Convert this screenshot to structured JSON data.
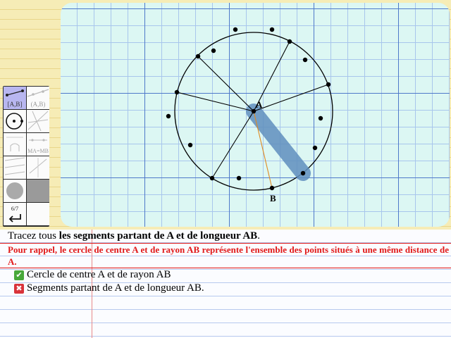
{
  "canvas": {
    "point_a_label": "A",
    "point_b_label": "B"
  },
  "toolbar": {
    "segment_tool_label": "[A,B]",
    "line_tool_label": "(A,B)",
    "perpendicular_tool_label": "MA=MB",
    "page_counter": "6/7",
    "back_icon": "return-arrow-icon"
  },
  "instructions": {
    "task_prefix": "Tracez tous ",
    "task_bold": "les segments partant de A et de longueur AB",
    "task_suffix": ".",
    "reminder": "Pour rappel, le cercle de centre A et de rayon AB représente l'ensemble des points situés à une même distance de A.",
    "checks": [
      {
        "status": "done",
        "label": "Cercle de centre A et de rayon AB"
      },
      {
        "status": "failed",
        "label": "Segments partant de A et de longueur AB."
      }
    ]
  },
  "colors": {
    "grid_major": "#4f79c9",
    "grid_minor": "#a8c6ec",
    "canvas_bg": "#dcf7f3",
    "highlight_bar": "#5f8ebd",
    "segment_ab": "#e08a20",
    "reminder_text": "#e11818",
    "check_ok": "#48a83a",
    "check_fail": "#d9333a"
  }
}
